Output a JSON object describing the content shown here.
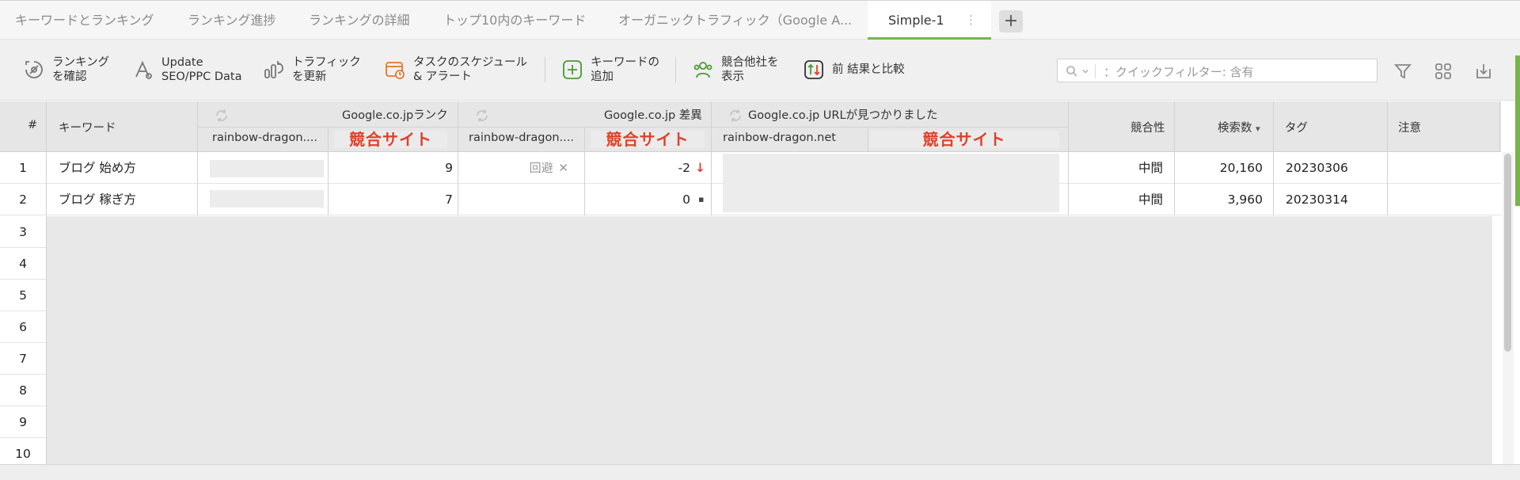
{
  "tabs": [
    {
      "label": "キーワードとランキング"
    },
    {
      "label": "ランキング進捗"
    },
    {
      "label": "ランキングの詳細"
    },
    {
      "label": "トップ10内のキーワード"
    },
    {
      "label": "オーガニックトラフィック（Google A..."
    },
    {
      "label": "Simple-1",
      "active": true
    }
  ],
  "tab_kebab": "⋮",
  "tab_add": "+",
  "toolbar": {
    "check_rankings": [
      "ランキング",
      "を確認"
    ],
    "update_data": [
      "Update",
      "SEO/PPC Data"
    ],
    "update_traffic": [
      "トラフィック",
      "を更新"
    ],
    "schedule": [
      "タスクのスケジュール",
      "& アラート"
    ],
    "add_keywords": [
      "キーワードの",
      "追加"
    ],
    "show_competitors": [
      "競合他社を",
      "表示"
    ],
    "compare": [
      "前 結果と比較"
    ]
  },
  "search": {
    "placeholder": "：クイックフィルター: 含有"
  },
  "colors": {
    "accent_green": "#76b54b",
    "competitor_red": "#e0402a",
    "down_arrow": "#e0402a"
  },
  "icons": [
    "radar-icon",
    "update-data-icon",
    "traffic-icon",
    "calendar-alarm-icon",
    "add-icon",
    "competitors-icon",
    "compare-icon",
    "search-icon",
    "filter-icon",
    "grid-icon",
    "download-icon",
    "refresh-icon"
  ],
  "header": {
    "num": "#",
    "keyword": "キーワード",
    "rank_group": "Google.co.jpランク",
    "diff_group": "Google.co.jp 差異",
    "url_group": "Google.co.jp URLが見つかりました",
    "site_truncated": "rainbow-dragon....",
    "site_full": "rainbow-dragon.net",
    "competitor": "競合サイト",
    "competition": "競合性",
    "search_volume": "検索数",
    "sort_indicator": "▾",
    "tag": "タグ",
    "note": "注意"
  },
  "rows": [
    {
      "num": "1",
      "keyword": "ブログ 始め方",
      "rank_comp": "9",
      "diff_own": "回避",
      "diff_own_x": "✕",
      "diff_comp": "-2",
      "diff_trend": "↓",
      "competition": "中間",
      "volume": "20,160",
      "tag": "20230306"
    },
    {
      "num": "2",
      "keyword": "ブログ 稼ぎ方",
      "rank_comp": "7",
      "diff_comp": "0",
      "diff_trend": "▪",
      "competition": "中間",
      "volume": "3,960",
      "tag": "20230314"
    }
  ],
  "empty_rows": [
    "3",
    "4",
    "5",
    "6",
    "7",
    "8",
    "9",
    "10"
  ]
}
